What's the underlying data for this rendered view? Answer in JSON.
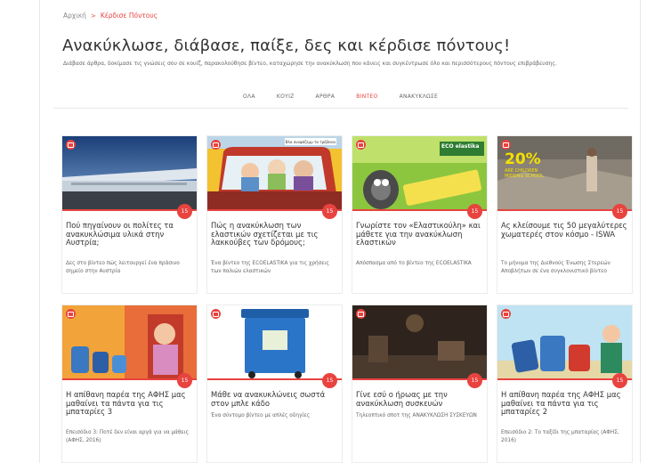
{
  "breadcrumb": {
    "home": "Αρχική",
    "separator": ">",
    "current": "Κέρδισε Πόντους"
  },
  "page": {
    "title": "Ανακύκλωσε, διάβασε, παίξε, δες και κέρδισε πόντους!",
    "subtitle": "Διάβασε άρθρα, δοκίμασε τις γνώσεις σου σε κουίζ, παρακολούθησε βίντεο, καταχώρησε την ανακύκλωση που κάνεις και συγκέντρωσε όλο και περισσότερους πόντους επιβράβευσης."
  },
  "tabs": [
    {
      "label": "ΟΛΑ"
    },
    {
      "label": "ΚΟΥΙΖ"
    },
    {
      "label": "ΑΡΘΡΑ"
    },
    {
      "label": "ΒΙΝΤΕΟ",
      "active": true
    },
    {
      "label": "ΑΝΑΚΥΚΛΩΣΕ"
    }
  ],
  "cards": [
    {
      "title": "Πού πηγαίνουν οι πολίτες τα ανακυκλώσιμα υλικά στην Αυστρία;",
      "desc": "Δες στο βίντεο πώς λειτουργεί ένα πράσινο σημείο στην Αυστρία",
      "points": "15"
    },
    {
      "title": "Πώς η ανακύκλωση των ελαστικών σχετίζεται με τις λακκούβες των δρόμους;",
      "desc": "Ένα βίντεο της ECOELASTIKA για τις χρήσεις των παλιών ελαστικών",
      "points": "15",
      "sign": "Βλα ανυψάζεμμ τα τρέβεναι"
    },
    {
      "title": "Γνωρίστε τον «Ελαστικούλη» και μάθετε για την ανακύκλωση ελαστικών",
      "desc": "Απόσπασμα από το βίντεο της ECOELASTIKA",
      "points": "15",
      "brand": "ECO elastika"
    },
    {
      "title": "Ας κλείσουμε τις 50 μεγαλύτερες χωματερές στον κόσμο - ISWA",
      "desc": "Το μήνυμα της Διεθνούς Ένωσης Στερεών Αποβλήτων σε ένα συγκλονιστικό βίντεο",
      "points": "15",
      "overlay": {
        "pct": "20%",
        "l1": "ARE CHILDREN",
        "l2": "MISSING SCHOOL"
      }
    },
    {
      "title": "Η απίθανη παρέα της ΑΦΗΣ μας μαθαίνει τα πάντα για τις μπαταρίες 3",
      "desc": "Επεισόδιο 3: Ποτέ δεν είναι αργά για να μάθεις (ΑΦΗΣ, 2016)",
      "points": "15"
    },
    {
      "title": "Μάθε να ανακυκλώνεις σωστά στον μπλε κάδο",
      "desc": "Ένα σύντομο βίντεο με απλές οδηγίες",
      "points": "15"
    },
    {
      "title": "Γίνε εσύ ο ήρωας με την ανακύκλωση συσκευών",
      "desc": "Τηλεοπτικό σποτ της ΑΝΑΚΥΚΛΩΣΗ ΣΥΣΚΕΥΩΝ",
      "points": "15"
    },
    {
      "title": "Η απίθανη παρέα της ΑΦΗΣ μας μαθαίνει τα πάντα για τις μπαταρίες 2",
      "desc": "Επεισόδιο 2: Το ταξίδι της μπαταρίας (ΑΦΗΣ, 2016)",
      "points": "15"
    }
  ],
  "colors": {
    "accent": "#e8433f",
    "title": "#333333",
    "muted": "#666666"
  },
  "icons": {
    "video": "video-camera-icon",
    "points": "points-badge"
  }
}
